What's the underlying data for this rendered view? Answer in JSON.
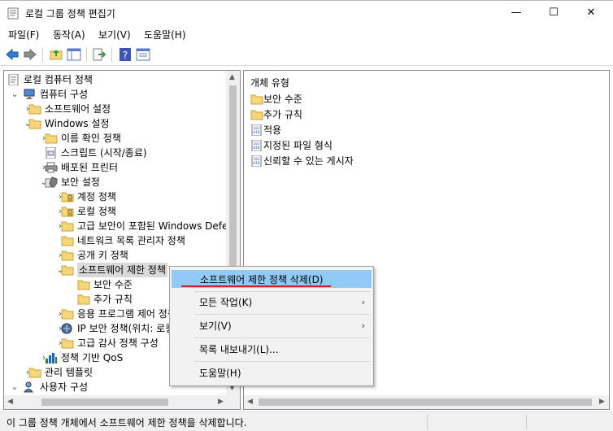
{
  "window": {
    "title": "로컬 그룹 정책 편집기",
    "minimize_glyph": "—",
    "maximize_glyph": "☐",
    "close_glyph": "✕"
  },
  "menu": [
    "파일(F)",
    "동작(A)",
    "보기(V)",
    "도움말(H)"
  ],
  "toolbar_icons": [
    "back-arrow-icon",
    "forward-arrow-icon",
    "up-folder-icon",
    "show-hide-tree-icon",
    "export-list-icon",
    "help-icon",
    "properties-view-icon"
  ],
  "tree": [
    {
      "label": "로컬 컴퓨터 정책",
      "level": 0,
      "arrow": "",
      "icon": "policy-doc-icon"
    },
    {
      "label": "컴퓨터 구성",
      "level": 0,
      "arrow": "expanded",
      "icon": "computer-icon"
    },
    {
      "label": "소프트웨어 설정",
      "level": 1,
      "arrow": "collapsed",
      "icon": "folder-icon"
    },
    {
      "label": "Windows 설정",
      "level": 1,
      "arrow": "expanded",
      "icon": "folder-icon"
    },
    {
      "label": "이름 확인 정책",
      "level": 2,
      "arrow": "collapsed",
      "icon": "folder-icon"
    },
    {
      "label": "스크립트 (시작/종료)",
      "level": 2,
      "arrow": "",
      "icon": "script-icon"
    },
    {
      "label": "배포된 프린터",
      "level": 2,
      "arrow": "collapsed",
      "icon": "printer-icon"
    },
    {
      "label": "보안 설정",
      "level": 2,
      "arrow": "expanded",
      "icon": "security-settings-icon"
    },
    {
      "label": "계정 정책",
      "level": 3,
      "arrow": "collapsed",
      "icon": "folder-lock-icon"
    },
    {
      "label": "로컬 정책",
      "level": 3,
      "arrow": "collapsed",
      "icon": "folder-lock-icon"
    },
    {
      "label": "고급 보안이 포함된 Windows Defender 방화벽",
      "level": 3,
      "arrow": "collapsed",
      "icon": "folder-icon"
    },
    {
      "label": "네트워크 목록 관리자 정책",
      "level": 3,
      "arrow": "",
      "icon": "folder-icon"
    },
    {
      "label": "공개 키 정책",
      "level": 3,
      "arrow": "collapsed",
      "icon": "folder-icon"
    },
    {
      "label": "소프트웨어 제한 정책",
      "level": 3,
      "arrow": "expanded",
      "icon": "folder-icon",
      "selected": true
    },
    {
      "label": "보안 수준",
      "level": 4,
      "arrow": "",
      "icon": "folder-icon"
    },
    {
      "label": "추가 규칙",
      "level": 4,
      "arrow": "",
      "icon": "folder-icon"
    },
    {
      "label": "응용 프로그램 제어 정책",
      "level": 3,
      "arrow": "collapsed",
      "icon": "folder-icon"
    },
    {
      "label": "IP 보안 정책(위치: 로컬 컴퓨터)",
      "level": 3,
      "arrow": "collapsed",
      "icon": "ip-security-icon"
    },
    {
      "label": "고급 감사 정책 구성",
      "level": 3,
      "arrow": "collapsed",
      "icon": "folder-icon"
    },
    {
      "label": "정책 기반 QoS",
      "level": 2,
      "arrow": "collapsed",
      "icon": "qos-chart-icon"
    },
    {
      "label": "관리 템플릿",
      "level": 1,
      "arrow": "collapsed",
      "icon": "folder-icon"
    },
    {
      "label": "사용자 구성",
      "level": 0,
      "arrow": "expanded",
      "icon": "user-icon"
    }
  ],
  "right_pane": {
    "header": "개체 유형",
    "items": [
      {
        "label": "보안 수준",
        "icon": "folder-icon"
      },
      {
        "label": "추가 규칙",
        "icon": "folder-icon"
      },
      {
        "label": "적용",
        "icon": "binary-doc-icon"
      },
      {
        "label": "지정된 파일 형식",
        "icon": "binary-doc-icon"
      },
      {
        "label": "신뢰할 수 있는 게시자",
        "icon": "binary-doc-icon"
      }
    ]
  },
  "context_menu": {
    "items": [
      {
        "label": "소프트웨어 제한 정책 삭제(D)",
        "submenu": false,
        "highlighted": true
      },
      {
        "label": "모든 작업(K)",
        "submenu": true
      },
      {
        "label": "보기(V)",
        "submenu": true
      },
      {
        "label": "목록 내보내기(L)...",
        "submenu": false
      },
      {
        "label": "도움말(H)",
        "submenu": false
      }
    ],
    "submenu_glyph": "›"
  },
  "status": {
    "text": "이 그룹 정책 개체에서 소프트웨어 제한 정책을 삭제합니다."
  },
  "colors": {
    "highlight": "#91c9f7",
    "underline": "#e0191b",
    "folder": "#f5d67a"
  }
}
